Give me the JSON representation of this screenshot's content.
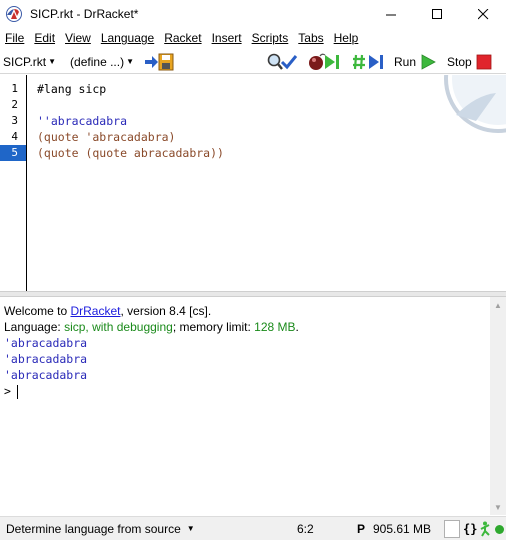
{
  "window": {
    "title": "SICP.rkt - DrRacket*"
  },
  "menu": [
    "File",
    "Edit",
    "View",
    "Language",
    "Racket",
    "Insert",
    "Scripts",
    "Tabs",
    "Help"
  ],
  "toolbar": {
    "file_dropdown": "SICP.rkt",
    "define_dropdown": "(define ...)",
    "run_label": "Run",
    "stop_label": "Stop"
  },
  "editor": {
    "line_numbers": [
      "1",
      "2",
      "3",
      "4",
      "5"
    ],
    "current_line": "5",
    "lines": [
      {
        "text": "#lang sicp"
      },
      {
        "text": ""
      },
      {
        "text": "''abracadabra"
      },
      {
        "text": "(quote 'abracadabra)"
      },
      {
        "text": "(quote (quote abracadabra))"
      }
    ]
  },
  "repl": {
    "welcome_prefix": "Welcome to ",
    "welcome_link": "DrRacket",
    "welcome_suffix": ", version 8.4 [cs].",
    "language_prefix": "Language: ",
    "language_name": "sicp, with debugging",
    "memory_prefix": "; memory limit: ",
    "memory_value": "128 MB",
    "memory_suffix": ".",
    "outputs": [
      "'abracadabra",
      "'abracadabra",
      "'abracadabra"
    ],
    "prompt": ">"
  },
  "status": {
    "language_selector": "Determine language from source",
    "position": "6:2",
    "memory_letter": "P",
    "memory": "905.61 MB",
    "braces": "{}"
  },
  "colors": {
    "constant": "#2a2ab8",
    "paren": "#8a4a2a",
    "current_line_bg": "#1f66c8",
    "language_green": "#1a8a1a",
    "stop_red": "#e0242c",
    "run_green": "#3db83d"
  }
}
